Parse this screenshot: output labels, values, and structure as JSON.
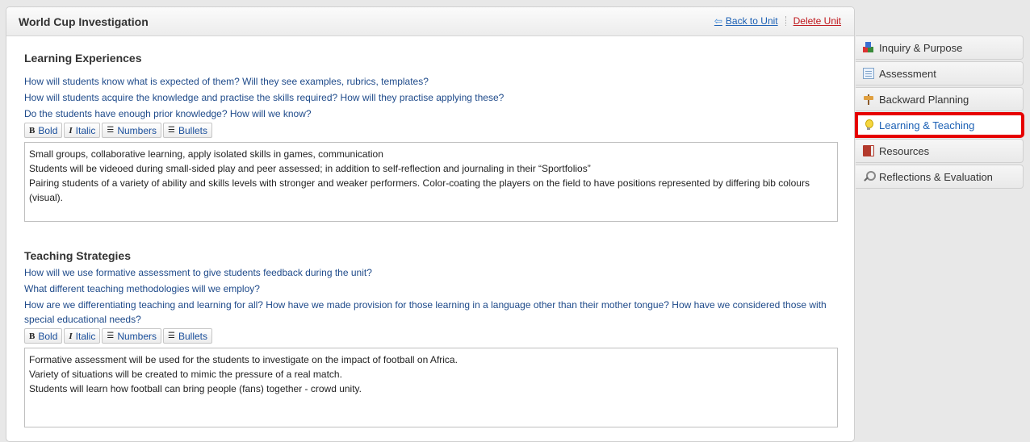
{
  "header": {
    "title": "World Cup Investigation",
    "back_link": "Back to Unit",
    "delete_link": "Delete Unit"
  },
  "toolbar": {
    "bold": "Bold",
    "italic": "Italic",
    "numbers": "Numbers",
    "bullets": "Bullets"
  },
  "learning": {
    "heading": "Learning Experiences",
    "prompts": [
      "How will students know what is expected of them? Will they see examples, rubrics, templates?",
      "How will students acquire the knowledge and practise the skills required? How will they practise applying these?",
      "Do the students have enough prior knowledge? How will we know?"
    ],
    "editor_lines": [
      "Small groups, collaborative learning, apply isolated skills in games, communication",
      "Students will be videoed during small-sided play and peer assessed; in addition to self-reflection and journaling in their “Sportfolios”",
      "Pairing students of a variety of ability and skills levels with stronger and weaker performers. Color-coating the players on the field to have positions represented by differing bib colours (visual)."
    ]
  },
  "teaching": {
    "heading": "Teaching Strategies",
    "prompts": [
      "How will we use formative assessment to give students feedback during the unit?",
      "What different teaching methodologies will we employ?",
      "How are we differentiating teaching and learning for all? How have we made provision for those learning in a language other than their mother tongue? How have we considered those with special educational needs?"
    ],
    "editor_lines": [
      "Formative assessment will be used for the students to investigate on the impact of football on Africa.",
      "Variety of situations will be created to mimic the pressure of a real match.",
      "Students will learn how football can bring people (fans) together - crowd unity."
    ]
  },
  "sidebar": {
    "items": [
      {
        "label": "Inquiry & Purpose",
        "icon": "blocks-icon"
      },
      {
        "label": "Assessment",
        "icon": "document-icon"
      },
      {
        "label": "Backward Planning",
        "icon": "signpost-icon"
      },
      {
        "label": "Learning & Teaching",
        "icon": "lightbulb-icon",
        "active": true
      },
      {
        "label": "Resources",
        "icon": "book-icon"
      },
      {
        "label": "Reflections & Evaluation",
        "icon": "magnifier-icon"
      }
    ]
  },
  "colors": {
    "link": "#1a5fb4",
    "delete": "#c0161b",
    "prompt_text": "#1e4a8a",
    "active_outline": "#e60000"
  }
}
